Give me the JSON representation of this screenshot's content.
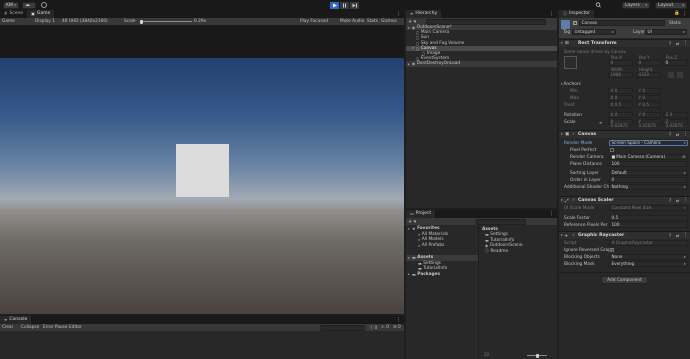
{
  "toolbar": {
    "account": "KW",
    "layers": "Layers",
    "layout": "Layout"
  },
  "scene_tabs": [
    "Scene",
    "Game"
  ],
  "game_bar": {
    "display_mode": "Game",
    "display": "Display 1",
    "resolution": "4K UHD (3840x2160)",
    "scale_label": "Scale",
    "scale_value": "0.29x",
    "play_focused": "Play Focused",
    "mute_audio": "Mute Audio",
    "stats": "Stats",
    "gizmos": "Gizmos"
  },
  "console": {
    "tab": "Console",
    "clear": "Clear",
    "collapse": "Collapse",
    "error_pause": "Error Pause",
    "editor": "Editor",
    "counts": [
      "0",
      "0",
      "0"
    ]
  },
  "hierarchy": {
    "tab": "Hierarchy",
    "items": [
      {
        "label": "OutdoorsScene*",
        "depth": 0,
        "kind": "scene"
      },
      {
        "label": "Main Camera",
        "depth": 1,
        "kind": "go"
      },
      {
        "label": "Sun",
        "depth": 1,
        "kind": "go"
      },
      {
        "label": "Sky and Fog Volume",
        "depth": 1,
        "kind": "go"
      },
      {
        "label": "Canvas",
        "depth": 1,
        "kind": "go",
        "selected": true
      },
      {
        "label": "Image",
        "depth": 2,
        "kind": "go"
      },
      {
        "label": "EventSystem",
        "depth": 1,
        "kind": "go"
      },
      {
        "label": "DontDestroyOnLoad",
        "depth": 0,
        "kind": "scene"
      }
    ]
  },
  "project": {
    "tab": "Project",
    "favorites": {
      "label": "Favorites",
      "items": [
        "All Materials",
        "All Models",
        "All Prefabs"
      ]
    },
    "assets_tree": {
      "label": "Assets",
      "items": [
        "Settings",
        "TutorialInfo"
      ]
    },
    "packages": "Packages",
    "assets_header": "Assets",
    "asset_items": [
      "Settings",
      "TutorialInfo",
      "OutdoorsScene",
      "Readme"
    ],
    "count": "20"
  },
  "inspector": {
    "tab": "Inspector",
    "object_name": "Canvas",
    "static": "Static",
    "tag_label": "Tag",
    "tag_value": "Untagged",
    "layer_label": "Layer",
    "layer_value": "UI",
    "rect_transform": {
      "title": "Rect Transform",
      "note": "Some values driven by Canvas.",
      "pos_headers": [
        "Pos X",
        "Pos Y",
        "Pos Z"
      ],
      "pos_values": [
        "0",
        "0",
        "0"
      ],
      "size_headers": [
        "Width",
        "Height"
      ],
      "size_values": [
        "1980",
        "4320"
      ],
      "anchors": "Anchors",
      "min": "Min",
      "min_values": [
        "0",
        "0"
      ],
      "max": "Max",
      "max_values": [
        "0",
        "0"
      ],
      "pivot": "Pivot",
      "pivot_values": [
        "0.5",
        "0.5"
      ],
      "rotation": "Rotation",
      "rotation_values": [
        "0",
        "0",
        "0"
      ],
      "scale": "Scale",
      "scale_values": [
        "0.02870",
        "0.02870",
        "0.02870"
      ]
    },
    "canvas": {
      "title": "Canvas",
      "render_mode_label": "Render Mode",
      "render_mode": "Screen Space - Camera",
      "pixel_perfect": "Pixel Perfect",
      "render_camera_label": "Render Camera",
      "render_camera": "Main Camera (Camera)",
      "plane_distance_label": "Plane Distance",
      "plane_distance": "100",
      "sorting_layer_label": "Sorting Layer",
      "sorting_layer": "Default",
      "order_label": "Order in Layer",
      "order": "0",
      "shader_label": "Additional Shader Cha",
      "shader": "Nothing"
    },
    "canvas_scaler": {
      "title": "Canvas Scaler",
      "ui_scale_label": "UI Scale Mode",
      "ui_scale": "Constant Pixel Size",
      "scale_factor_label": "Scale Factor",
      "scale_factor": "0.5",
      "ref_label": "Reference Pixels Per U",
      "ref": "100"
    },
    "raycaster": {
      "title": "Graphic Raycaster",
      "script_label": "Script",
      "script": "GraphicRaycaster",
      "ignore_label": "Ignore Reversed Grap",
      "blocking_objects_label": "Blocking Objects",
      "blocking_objects": "None",
      "blocking_mask_label": "Blocking Mask",
      "blocking_mask": "Everything"
    },
    "add_component": "Add Component"
  }
}
